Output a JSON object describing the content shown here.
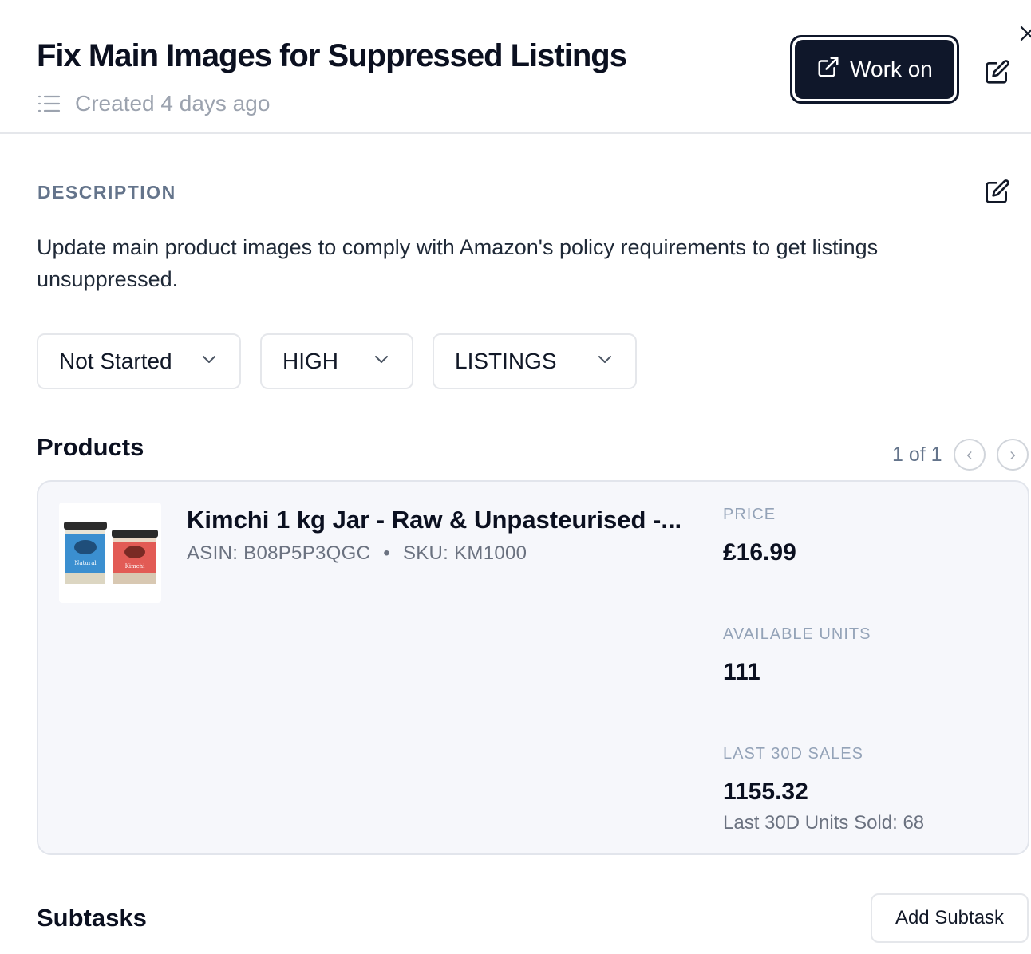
{
  "header": {
    "title": "Fix Main Images for Suppressed Listings",
    "created": "Created 4 days ago",
    "work_on_label": "Work on"
  },
  "description": {
    "label": "DESCRIPTION",
    "text": "Update main product images to comply with Amazon's policy requirements to get listings unsuppressed."
  },
  "filters": {
    "status": "Not Started",
    "priority": "HIGH",
    "category": "LISTINGS"
  },
  "products": {
    "heading": "Products",
    "pagination": "1 of 1",
    "item": {
      "title": "Kimchi 1 kg Jar - Raw & Unpasteurised -...",
      "asin": "ASIN: B08P5P3QGC",
      "separator": "•",
      "sku": "SKU: KM1000",
      "image_labels": {
        "left": "Natural",
        "right": "Kimchi"
      },
      "price_label": "PRICE",
      "price": "£16.99",
      "units_label": "AVAILABLE UNITS",
      "units": "111",
      "sales_label": "LAST 30D SALES",
      "sales": "1155.32",
      "units_sold": "Last 30D Units Sold: 68"
    }
  },
  "subtasks": {
    "heading": "Subtasks",
    "add_label": "Add Subtask"
  },
  "colors": {
    "primary": "#0f172a",
    "card_bg": "#f6f7fb",
    "muted": "#9ca3af"
  },
  "icons": [
    "list-icon",
    "external-link-icon",
    "edit-icon",
    "close-icon",
    "chevron-down-icon",
    "chevron-left-icon",
    "chevron-right-icon"
  ]
}
